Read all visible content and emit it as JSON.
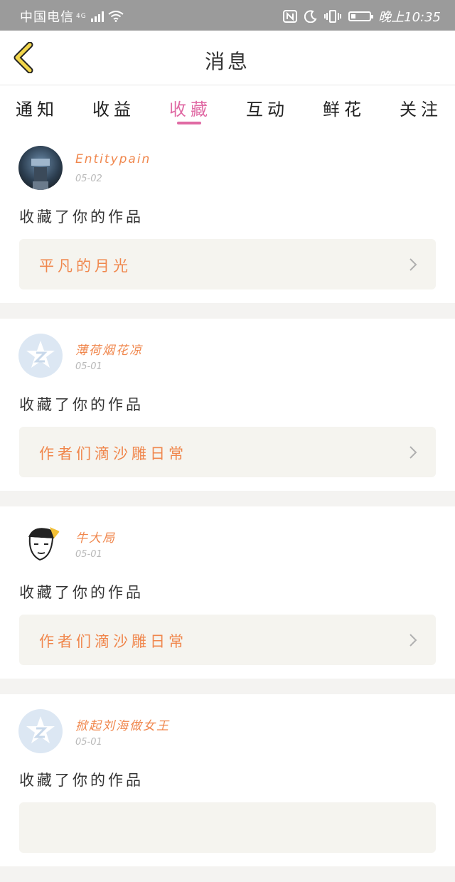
{
  "status_bar": {
    "carrier": "中国电信",
    "network": "4G",
    "time": "晚上10:35"
  },
  "nav": {
    "title": "消息"
  },
  "tabs": [
    {
      "label": "通知"
    },
    {
      "label": "收益"
    },
    {
      "label": "收藏",
      "active": true
    },
    {
      "label": "互动"
    },
    {
      "label": "鲜花"
    },
    {
      "label": "关注"
    }
  ],
  "feed": [
    {
      "user": "Entitypain",
      "date": "05-02",
      "avatar": "dark-anime-avatar",
      "action": "收藏了你的作品",
      "work": "平凡的月光"
    },
    {
      "user": "薄荷烟花凉",
      "date": "05-01",
      "avatar": "qq-default-avatar",
      "action": "收藏了你的作品",
      "work": "作者们滴沙雕日常"
    },
    {
      "user": "牛大局",
      "date": "05-01",
      "avatar": "cartoon-face-avatar",
      "action": "收藏了你的作品",
      "work": "作者们滴沙雕日常"
    },
    {
      "user": "掀起刘海做女王",
      "date": "05-01",
      "avatar": "qq-default-avatar",
      "action": "收藏了你的作品",
      "work": ""
    }
  ],
  "colors": {
    "accent_pink": "#e06aa4",
    "accent_orange": "#f0874d",
    "back_arrow": "#f2d64b"
  }
}
